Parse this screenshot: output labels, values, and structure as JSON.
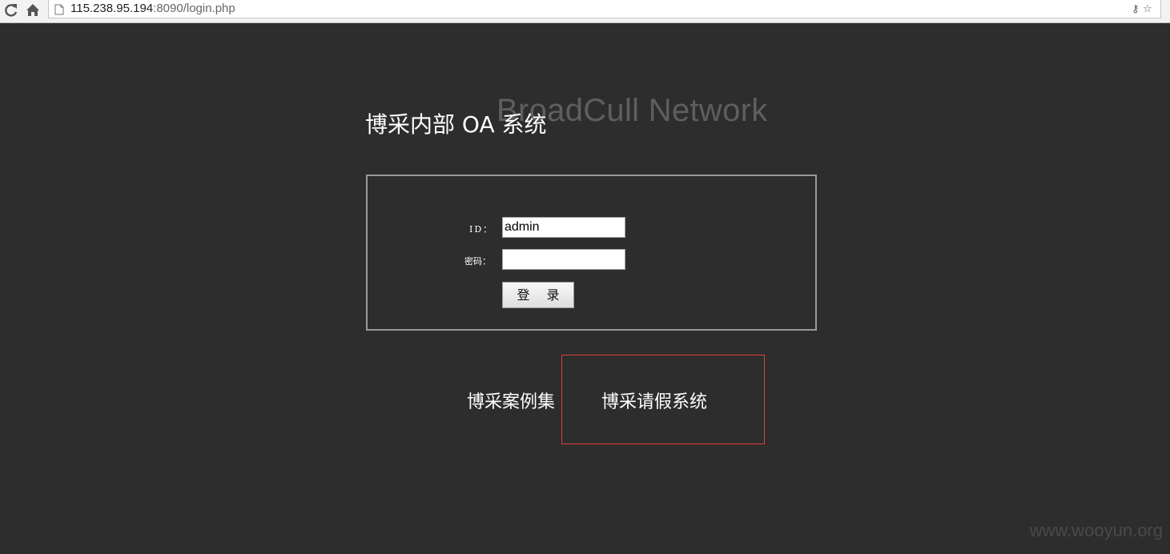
{
  "browser": {
    "url_host": "115.238.95.194",
    "url_rest": ":8090/login.php"
  },
  "page": {
    "watermark_title": "BroadCull Network",
    "title": "博采内部 OA 系统",
    "form": {
      "id_label": "ID：",
      "id_value": "admin",
      "password_label": "密码：",
      "password_value": "",
      "login_button": "登 录"
    },
    "links": {
      "cases": "博采案例集",
      "leave_system": "博采请假系统"
    },
    "site_watermark": "www.wooyun.org"
  },
  "colors": {
    "background": "#2d2d2d",
    "highlight": "#e03c3c"
  }
}
